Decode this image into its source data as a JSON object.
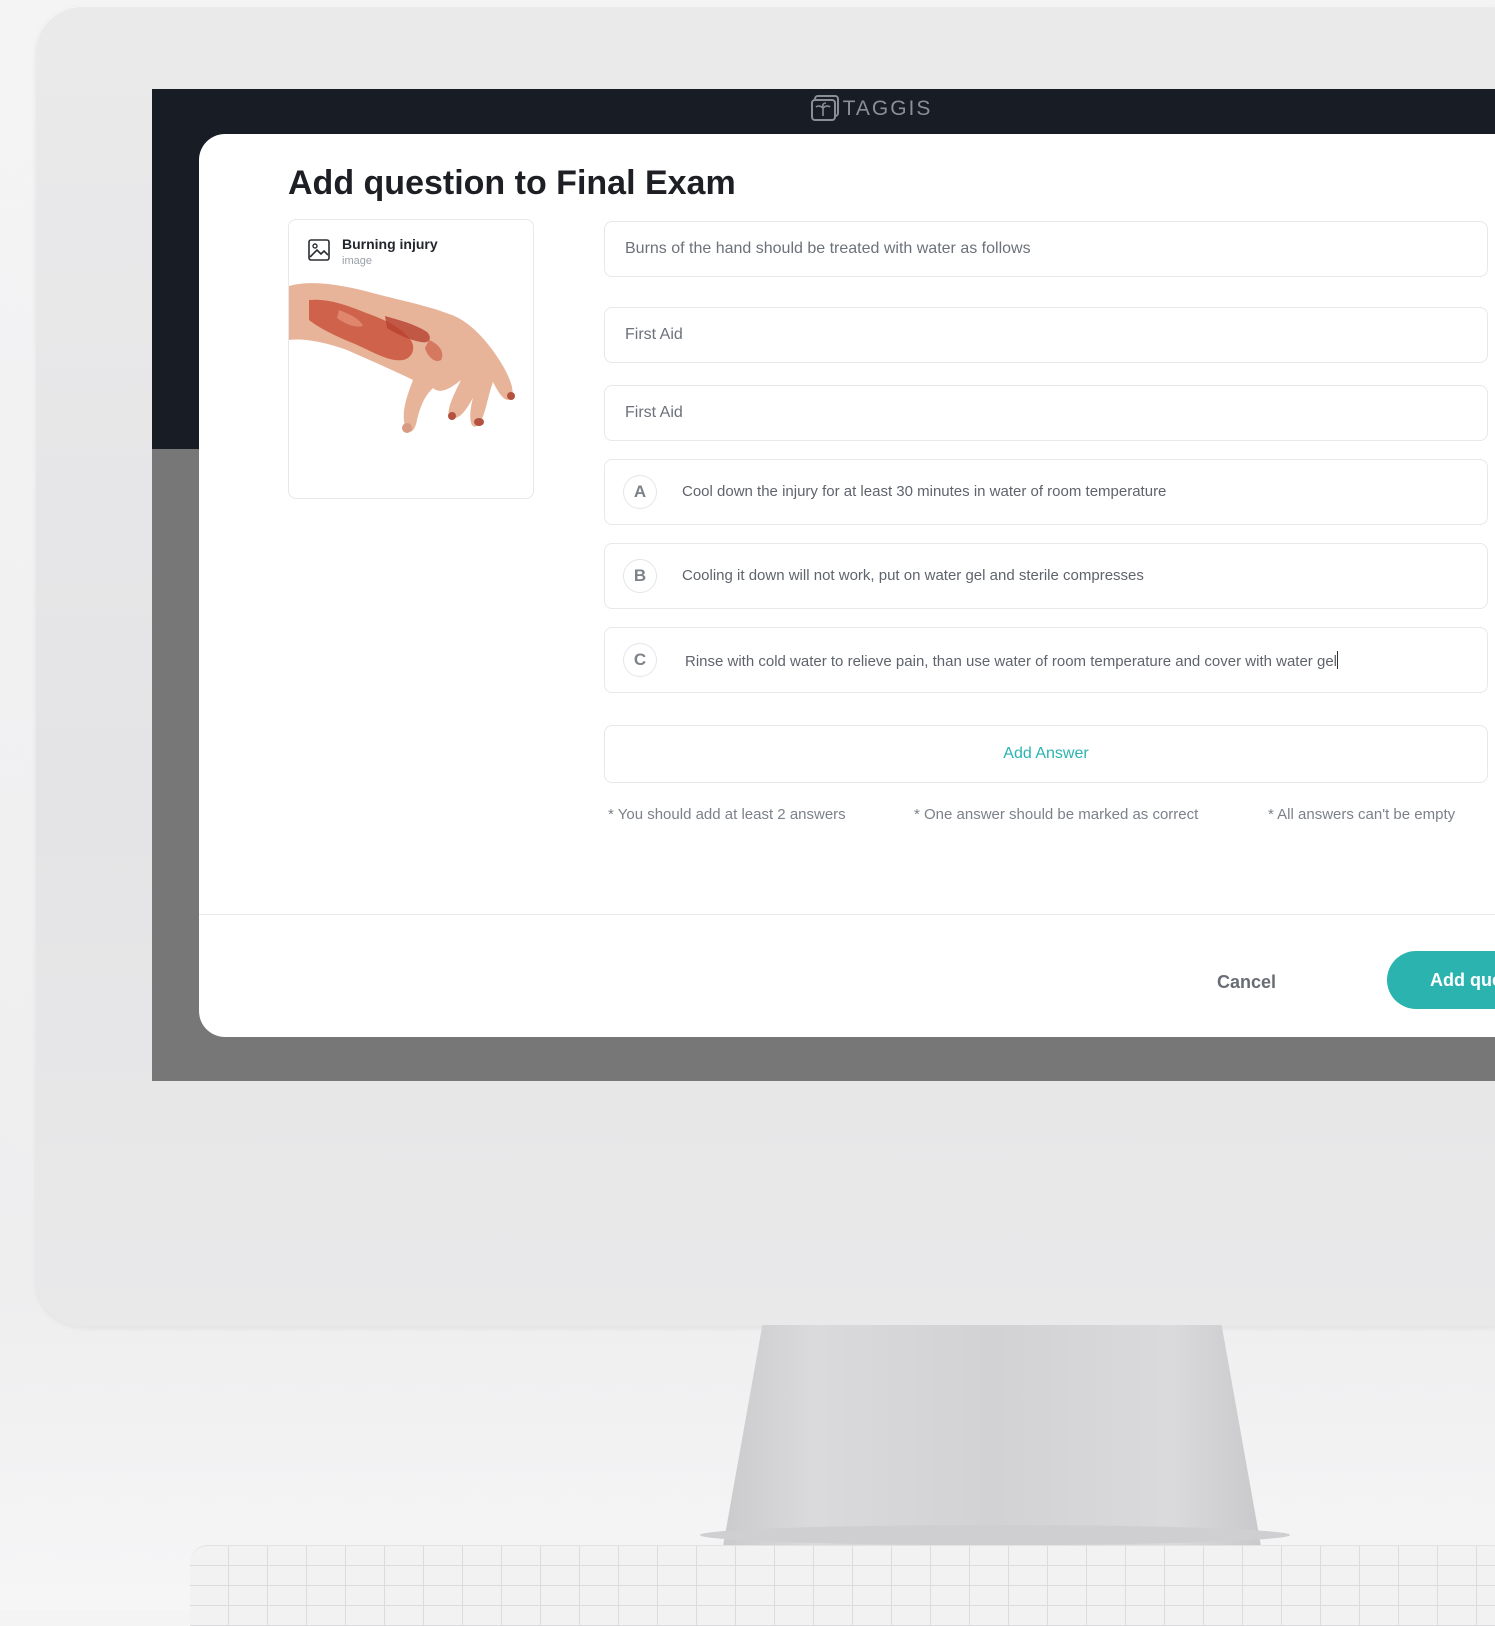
{
  "app": {
    "brand": "TAGGIS"
  },
  "modal": {
    "title": "Add question to Final Exam",
    "media": {
      "name": "Burning injury",
      "type": "image"
    },
    "question": "Burns of the hand should be treated with water as follows",
    "field2": "First Aid",
    "field3": "First Aid",
    "answers": [
      {
        "letter": "A",
        "text": "Cool down the injury for at least 30 minutes in water of room temperature"
      },
      {
        "letter": "B",
        "text": "Cooling it down will not work, put on water gel and sterile compresses"
      },
      {
        "letter": "C",
        "text": "Rinse with cold water to relieve pain, than use water of room temperature and cover with water gel"
      }
    ],
    "add_answer_label": "Add Answer",
    "hints": [
      "* You should add at least 2 answers",
      "* One answer should be marked as correct",
      "* All answers can't be empty"
    ],
    "cancel_label": "Cancel",
    "submit_label": "Add question"
  },
  "colors": {
    "accent": "#2bb3b0",
    "topbar": "#181c25",
    "overlay": "#777777"
  }
}
